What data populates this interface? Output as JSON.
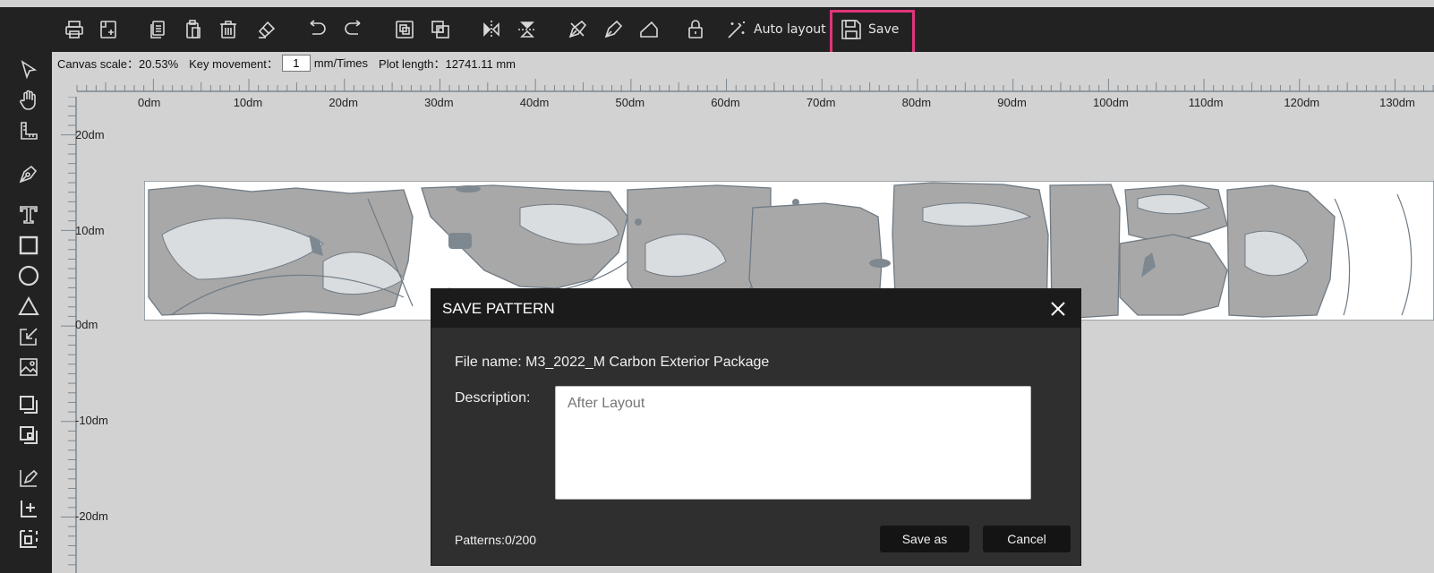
{
  "toolbar": {
    "auto_layout_label": "Auto layout",
    "save_label": "Save",
    "highlight_color": "#e0357a",
    "icons": [
      "print-icon",
      "new-file-icon",
      "copy-icon",
      "paste-icon",
      "delete-icon",
      "eraser-icon",
      "undo-icon",
      "redo-icon",
      "group-icon",
      "ungroup-icon",
      "flip-horizontal-icon",
      "flip-vertical-icon",
      "edit-node-icon",
      "pen-icon",
      "shape-icon",
      "lock-icon",
      "magic-wand-icon",
      "save-icon"
    ]
  },
  "left_tools": [
    "select-arrow-icon",
    "hand-icon",
    "ruler-icon",
    "pen-tool-icon",
    "text-tool-icon",
    "rectangle-tool-icon",
    "circle-tool-icon",
    "triangle-tool-icon",
    "import-icon",
    "image-icon",
    "layer-icon",
    "layer-delete-icon",
    "baseline-edit-icon",
    "baseline-add-icon",
    "selection-box-icon"
  ],
  "infobar": {
    "canvas_scale": "Canvas scale：20.53%",
    "key_movement_label": "Key movement：",
    "key_movement_value": "1",
    "key_movement_unit": "mm/Times",
    "plot_length": "Plot length：12741.11 mm"
  },
  "ruler": {
    "h_labels": [
      "0dm",
      "10dm",
      "20dm",
      "30dm",
      "40dm",
      "50dm",
      "60dm",
      "70dm",
      "80dm",
      "90dm",
      "100dm",
      "110dm",
      "120dm",
      "130dm"
    ],
    "v_labels": [
      "20dm",
      "10dm",
      "0dm",
      "-10dm",
      "-20dm"
    ]
  },
  "dialog": {
    "title": "SAVE PATTERN",
    "file_name": "File name: M3_2022_M Carbon Exterior Package",
    "description_label": "Description:",
    "description_placeholder": "After Layout",
    "patterns_count": "Patterns:0/200",
    "save_as_label": "Save as",
    "cancel_label": "Cancel"
  }
}
